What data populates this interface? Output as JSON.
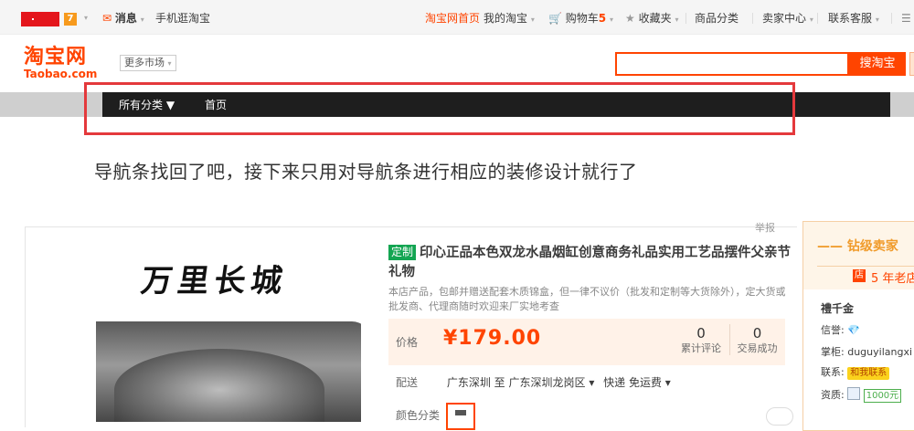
{
  "topbar": {
    "orange_icon_char": "7",
    "messages": "消息",
    "mobile": "手机逛淘宝",
    "home": "淘宝网首页",
    "my_taobao": "我的淘宝",
    "cart_label": "购物车",
    "cart_count": "5",
    "favorites": "收藏夹",
    "categories": "商品分类",
    "seller_center": "卖家中心",
    "customer_service": "联系客服"
  },
  "header": {
    "logo_cn": "淘宝网",
    "logo_en": "Taobao.com",
    "more_markets": "更多市场",
    "search_value": "",
    "search_button": "搜淘宝"
  },
  "nav": {
    "all_categories": "所有分类 ▼",
    "home": "首页"
  },
  "annotation": "导航条找回了吧，接下来只用对导航条进行相应的装修设计就行了",
  "product": {
    "report": "举报",
    "image_text": "万里长城",
    "tag": "定制",
    "title": "印心正品本色双龙水晶烟缸创意商务礼品实用工艺品摆件父亲节礼物",
    "subtitle": "本店产品，包邮并赠送配套木质锦盒，但一律不议价（批发和定制等大货除外），定大货或批发商、代理商随时欢迎来厂实地考查",
    "price_label": "价格",
    "price": "¥179.00",
    "reviews_count": "0",
    "reviews_label": "累计评论",
    "sales_count": "0",
    "sales_label": "交易成功",
    "shipping_label": "配送",
    "shipping_from": "广东深圳 至",
    "shipping_to": "广东深圳龙岗区 ▾",
    "shipping_method": "快递 免运费 ▾",
    "color_label": "颜色分类"
  },
  "shop": {
    "level": "—— 钻级卖家",
    "old_shop": "5 年老店",
    "name": "禮千金",
    "reputation_label": "信誉:",
    "seller_label": "掌柜:",
    "seller": "duguyilangxi",
    "contact_label": "联系:",
    "contact_badge": "和我联系",
    "qualification_label": "资质:",
    "deposit": "1000元"
  }
}
